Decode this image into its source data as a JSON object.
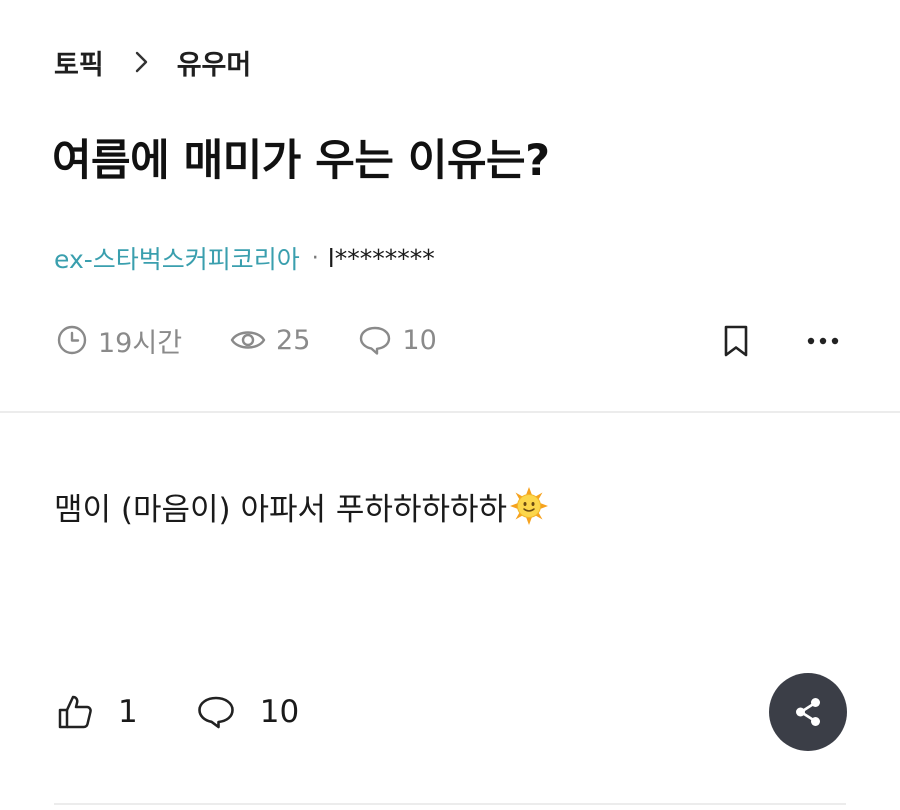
{
  "breadcrumb": {
    "parent": "토픽",
    "current": "유우머"
  },
  "post": {
    "title": "여름에 매미가 우는 이유는?",
    "company": "ex-스타벅스커피코리아",
    "separator": "·",
    "nickname": "l********",
    "time": "19시간",
    "views": "25",
    "comments": "10",
    "body": "맴이 (마음이) 아파서 푸하하하하하"
  },
  "actions": {
    "likes": "1",
    "comments": "10"
  },
  "icons": {
    "breadcrumb_separator": "chevron-right-icon",
    "time": "clock-icon",
    "views": "eye-icon",
    "comments": "speech-bubble-icon",
    "bookmark": "bookmark-icon",
    "more": "more-dots-icon",
    "emoji": "sun-face-emoji",
    "like": "thumbs-up-icon",
    "share": "share-icon"
  },
  "colors": {
    "company_link": "#3a9fae",
    "meta_gray": "#8a8a8a",
    "share_button_bg": "#3b3e47",
    "divider": "#ececec"
  }
}
